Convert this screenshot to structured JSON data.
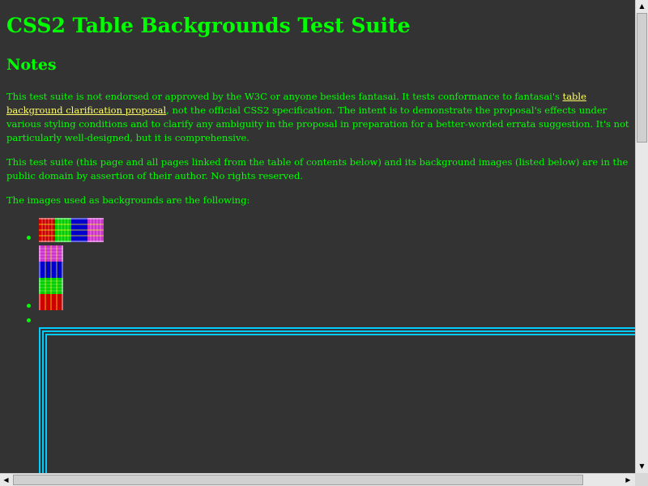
{
  "page": {
    "title": "CSS2 Table Backgrounds Test Suite",
    "notes_heading": "Notes",
    "paragraph1_before_link": "This test suite is not endorsed or approved by the W3C or anyone besides fantasai. It tests conformance to fantasai's ",
    "paragraph1_link": "table background clarification proposal",
    "paragraph1_after_link": ", not the official CSS2 specification. The intent is to demonstrate the proposal's effects under various styling conditions and to clarify any ambiguity in the proposal in preparation for a better-worded errata suggestion. It's not particularly well-designed, but it is comprehensive.",
    "paragraph2": "This test suite (this page and all pages linked from the table of contents below) and its background images (listed below) are in the public domain by assertion of their author. No rights reserved.",
    "paragraph3": "The images used as backgrounds are the following:"
  },
  "colors": {
    "background": "#333333",
    "text": "#00ff00",
    "link": "#ffff66",
    "border_image": "#00ccff"
  },
  "images": {
    "horizontal_stripe_colors": [
      "#cc0000",
      "#00cc00",
      "#0000cc",
      "#cc33cc"
    ],
    "vertical_stripe_colors": [
      "#cc33cc",
      "#0000cc",
      "#00cc00",
      "#cc0000"
    ]
  },
  "scrollbars": {
    "up_arrow": "▲",
    "down_arrow": "▼",
    "left_arrow": "◀",
    "right_arrow": "▶"
  }
}
